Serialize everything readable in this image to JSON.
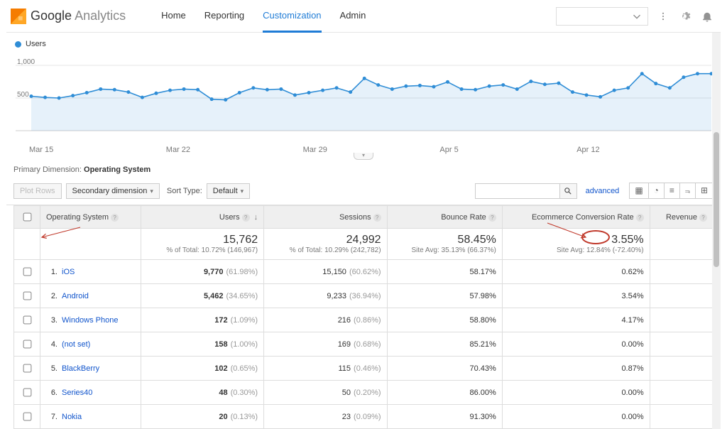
{
  "brand": {
    "g": "Google",
    "a": "Analytics"
  },
  "nav": {
    "home": "Home",
    "reporting": "Reporting",
    "customization": "Customization",
    "admin": "Admin"
  },
  "legend": {
    "users": "Users"
  },
  "chart_data": {
    "type": "line",
    "title": "",
    "xlabel": "",
    "ylabel": "",
    "ylim": [
      0,
      1100
    ],
    "yticks": [
      500,
      1000
    ],
    "categories": [
      "Mar 15",
      "Mar 22",
      "Mar 29",
      "Apr 5",
      "Apr 12"
    ],
    "series": [
      {
        "name": "Users",
        "values": [
          580,
          560,
          550,
          590,
          640,
          700,
          690,
          650,
          560,
          630,
          680,
          700,
          690,
          530,
          520,
          640,
          720,
          690,
          700,
          600,
          640,
          680,
          720,
          650,
          880,
          770,
          700,
          750,
          760,
          740,
          820,
          700,
          690,
          750,
          770,
          700,
          830,
          780,
          800,
          650,
          600,
          570,
          680,
          720,
          960,
          793,
          720,
          900,
          960,
          960
        ]
      }
    ]
  },
  "yticks": {
    "a": "1,000",
    "b": "500"
  },
  "xticks": {
    "a": "Mar 15",
    "b": "Mar 22",
    "c": "Mar 29",
    "d": "Apr 5",
    "e": "Apr 12"
  },
  "primary_dim": {
    "label": "Primary Dimension:",
    "value": "Operating System"
  },
  "controls": {
    "plot_rows": "Plot Rows",
    "secondary_dim": "Secondary dimension",
    "sort_label": "Sort Type:",
    "sort_default": "Default",
    "advanced": "advanced"
  },
  "columns": {
    "os": "Operating System",
    "users": "Users",
    "sessions": "Sessions",
    "bounce": "Bounce Rate",
    "ecomm": "Ecommerce Conversion Rate",
    "revenue": "Revenue"
  },
  "summary": {
    "users": {
      "v": "15,762",
      "sub": "% of Total: 10.72% (146,967)"
    },
    "sessions": {
      "v": "24,992",
      "sub": "% of Total: 10.29% (242,782)"
    },
    "bounce": {
      "v": "58.45%",
      "sub": "Site Avg: 35.13% (66.37%)"
    },
    "ecomm": {
      "v": "3.55%",
      "sub": "Site Avg: 12.84% (-72.40%)"
    }
  },
  "rows": [
    {
      "idx": "1.",
      "name": "iOS",
      "users_v": "9,770",
      "users_p": "(61.98%)",
      "sess_v": "15,150",
      "sess_p": "(60.62%)",
      "bounce": "58.17%",
      "ecomm": "0.62%"
    },
    {
      "idx": "2.",
      "name": "Android",
      "users_v": "5,462",
      "users_p": "(34.65%)",
      "sess_v": "9,233",
      "sess_p": "(36.94%)",
      "bounce": "57.98%",
      "ecomm": "3.54%"
    },
    {
      "idx": "3.",
      "name": "Windows Phone",
      "users_v": "172",
      "users_p": "(1.09%)",
      "sess_v": "216",
      "sess_p": "(0.86%)",
      "bounce": "58.80%",
      "ecomm": "4.17%"
    },
    {
      "idx": "4.",
      "name": "(not set)",
      "users_v": "158",
      "users_p": "(1.00%)",
      "sess_v": "169",
      "sess_p": "(0.68%)",
      "bounce": "85.21%",
      "ecomm": "0.00%"
    },
    {
      "idx": "5.",
      "name": "BlackBerry",
      "users_v": "102",
      "users_p": "(0.65%)",
      "sess_v": "115",
      "sess_p": "(0.46%)",
      "bounce": "70.43%",
      "ecomm": "0.87%"
    },
    {
      "idx": "6.",
      "name": "Series40",
      "users_v": "48",
      "users_p": "(0.30%)",
      "sess_v": "50",
      "sess_p": "(0.20%)",
      "bounce": "86.00%",
      "ecomm": "0.00%"
    },
    {
      "idx": "7.",
      "name": "Nokia",
      "users_v": "20",
      "users_p": "(0.13%)",
      "sess_v": "23",
      "sess_p": "(0.09%)",
      "bounce": "91.30%",
      "ecomm": "0.00%"
    }
  ]
}
